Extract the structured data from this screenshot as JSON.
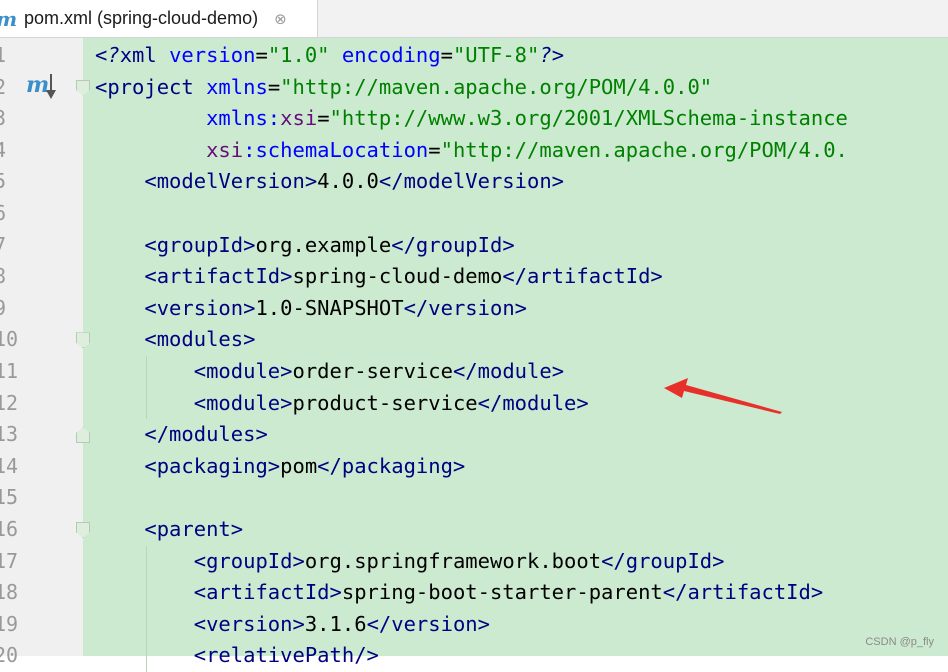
{
  "tab": {
    "icon": "maven-m-icon",
    "label": "pom.xml (spring-cloud-demo)",
    "close_glyph": "⊗"
  },
  "gutter": {
    "maven_icon_text": "m"
  },
  "lines": [
    {
      "no": "1",
      "tokens": [
        {
          "t": "pi",
          "v": "<?"
        },
        {
          "t": "tag",
          "v": "xml "
        },
        {
          "t": "attr",
          "v": "version"
        },
        {
          "t": "plain",
          "v": "="
        },
        {
          "t": "val",
          "v": "\"1.0\""
        },
        {
          "t": "plain",
          "v": " "
        },
        {
          "t": "attr",
          "v": "encoding"
        },
        {
          "t": "plain",
          "v": "="
        },
        {
          "t": "val",
          "v": "\"UTF-8\""
        },
        {
          "t": "pi",
          "v": "?>"
        }
      ]
    },
    {
      "no": "2",
      "tokens": [
        {
          "t": "tag",
          "v": "<project "
        },
        {
          "t": "attr",
          "v": "xmlns"
        },
        {
          "t": "plain",
          "v": "="
        },
        {
          "t": "val",
          "v": "\"http://maven.apache.org/POM/4.0.0\""
        }
      ]
    },
    {
      "no": "3",
      "tokens": [
        {
          "t": "plain",
          "v": "         "
        },
        {
          "t": "attr",
          "v": "xmlns:"
        },
        {
          "t": "ns",
          "v": "xsi"
        },
        {
          "t": "plain",
          "v": "="
        },
        {
          "t": "val",
          "v": "\"http://www.w3.org/2001/XMLSchema-instance"
        }
      ]
    },
    {
      "no": "4",
      "tokens": [
        {
          "t": "plain",
          "v": "         "
        },
        {
          "t": "ns",
          "v": "xsi"
        },
        {
          "t": "attr",
          "v": ":schemaLocation"
        },
        {
          "t": "plain",
          "v": "="
        },
        {
          "t": "val",
          "v": "\"http://maven.apache.org/POM/4.0."
        }
      ]
    },
    {
      "no": "5",
      "tokens": [
        {
          "t": "plain",
          "v": "    "
        },
        {
          "t": "tag",
          "v": "<modelVersion>"
        },
        {
          "t": "plain",
          "v": "4.0.0"
        },
        {
          "t": "tag",
          "v": "</modelVersion>"
        }
      ]
    },
    {
      "no": "6",
      "tokens": []
    },
    {
      "no": "7",
      "tokens": [
        {
          "t": "plain",
          "v": "    "
        },
        {
          "t": "tag",
          "v": "<groupId>"
        },
        {
          "t": "plain",
          "v": "org.example"
        },
        {
          "t": "tag",
          "v": "</groupId>"
        }
      ]
    },
    {
      "no": "8",
      "tokens": [
        {
          "t": "plain",
          "v": "    "
        },
        {
          "t": "tag",
          "v": "<artifactId>"
        },
        {
          "t": "plain",
          "v": "spring-cloud-demo"
        },
        {
          "t": "tag",
          "v": "</artifactId>"
        }
      ]
    },
    {
      "no": "9",
      "tokens": [
        {
          "t": "plain",
          "v": "    "
        },
        {
          "t": "tag",
          "v": "<version>"
        },
        {
          "t": "plain",
          "v": "1.0-SNAPSHOT"
        },
        {
          "t": "tag",
          "v": "</version>"
        }
      ]
    },
    {
      "no": "10",
      "tokens": [
        {
          "t": "plain",
          "v": "    "
        },
        {
          "t": "tag",
          "v": "<modules>"
        }
      ]
    },
    {
      "no": "11",
      "tokens": [
        {
          "t": "plain",
          "v": "        "
        },
        {
          "t": "tag",
          "v": "<module>"
        },
        {
          "t": "plain",
          "v": "order-service"
        },
        {
          "t": "tag",
          "v": "</module>"
        }
      ]
    },
    {
      "no": "12",
      "tokens": [
        {
          "t": "plain",
          "v": "        "
        },
        {
          "t": "tag",
          "v": "<module>"
        },
        {
          "t": "plain",
          "v": "product-service"
        },
        {
          "t": "tag",
          "v": "</module>"
        }
      ]
    },
    {
      "no": "13",
      "tokens": [
        {
          "t": "plain",
          "v": "    "
        },
        {
          "t": "tag",
          "v": "</modules>"
        }
      ]
    },
    {
      "no": "14",
      "tokens": [
        {
          "t": "plain",
          "v": "    "
        },
        {
          "t": "tag",
          "v": "<packaging>"
        },
        {
          "t": "plain",
          "v": "pom"
        },
        {
          "t": "tag",
          "v": "</packaging>"
        }
      ]
    },
    {
      "no": "15",
      "tokens": []
    },
    {
      "no": "16",
      "tokens": [
        {
          "t": "plain",
          "v": "    "
        },
        {
          "t": "tag",
          "v": "<parent>"
        }
      ]
    },
    {
      "no": "17",
      "tokens": [
        {
          "t": "plain",
          "v": "        "
        },
        {
          "t": "tag",
          "v": "<groupId>"
        },
        {
          "t": "plain",
          "v": "org.springframework.boot"
        },
        {
          "t": "tag",
          "v": "</groupId>"
        }
      ]
    },
    {
      "no": "18",
      "tokens": [
        {
          "t": "plain",
          "v": "        "
        },
        {
          "t": "tag",
          "v": "<artifactId>"
        },
        {
          "t": "plain",
          "v": "spring-boot-starter-parent"
        },
        {
          "t": "tag",
          "v": "</artifactId>"
        }
      ]
    },
    {
      "no": "19",
      "tokens": [
        {
          "t": "plain",
          "v": "        "
        },
        {
          "t": "tag",
          "v": "<version>"
        },
        {
          "t": "plain",
          "v": "3.1.6"
        },
        {
          "t": "tag",
          "v": "</version>"
        }
      ]
    },
    {
      "no": "20",
      "tokens": [
        {
          "t": "plain",
          "v": "        "
        },
        {
          "t": "tag",
          "v": "<relativePath/>"
        }
      ]
    }
  ],
  "annotation": {
    "color": "#e8302a"
  },
  "watermark": "CSDN @p_fly"
}
